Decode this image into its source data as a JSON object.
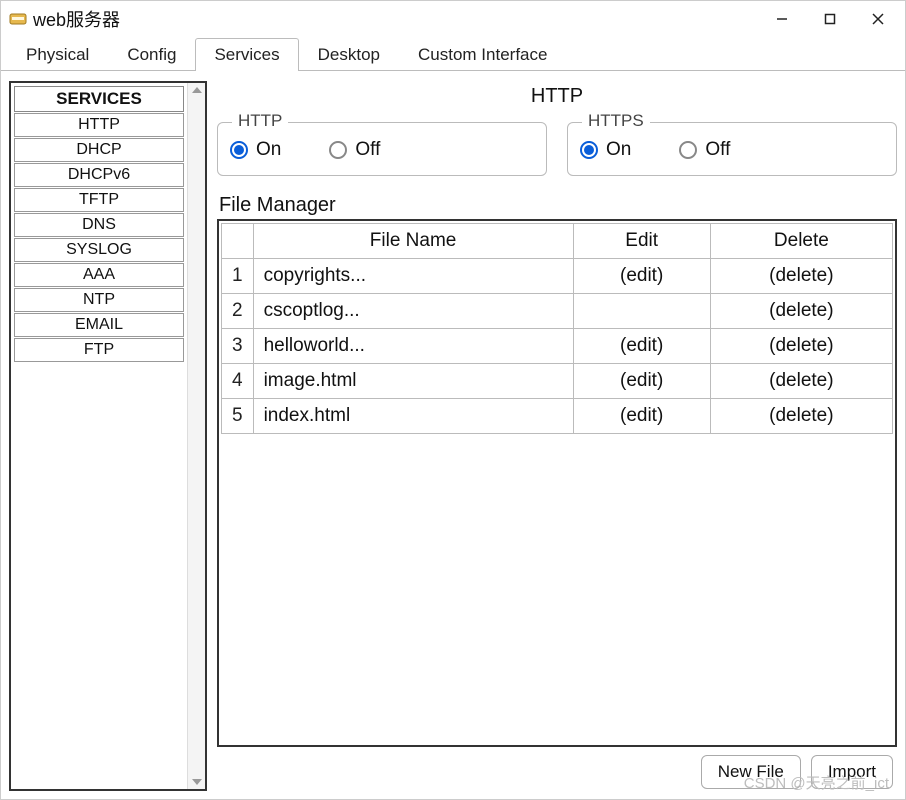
{
  "window": {
    "title": "web服务器"
  },
  "tabs": {
    "physical": "Physical",
    "config": "Config",
    "services": "Services",
    "desktop": "Desktop",
    "custom": "Custom Interface",
    "active": "services"
  },
  "sidebar": {
    "header": "SERVICES",
    "items": [
      "HTTP",
      "DHCP",
      "DHCPv6",
      "TFTP",
      "DNS",
      "SYSLOG",
      "AAA",
      "NTP",
      "EMAIL",
      "FTP"
    ]
  },
  "panel": {
    "title": "HTTP",
    "http": {
      "legend": "HTTP",
      "on_label": "On",
      "off_label": "Off",
      "on": true
    },
    "https": {
      "legend": "HTTPS",
      "on_label": "On",
      "off_label": "Off",
      "on": true
    },
    "file_manager_label": "File Manager",
    "table": {
      "headers": {
        "filename": "File Name",
        "edit": "Edit",
        "delete": "Delete"
      },
      "rows": [
        {
          "n": "1",
          "file": "copyrights...",
          "edit": "(edit)",
          "del": "(delete)"
        },
        {
          "n": "2",
          "file": "cscoptlog...",
          "edit": "",
          "del": "(delete)"
        },
        {
          "n": "3",
          "file": "helloworld...",
          "edit": "(edit)",
          "del": "(delete)"
        },
        {
          "n": "4",
          "file": "image.html",
          "edit": "(edit)",
          "del": "(delete)"
        },
        {
          "n": "5",
          "file": "index.html",
          "edit": "(edit)",
          "del": "(delete)"
        }
      ]
    },
    "buttons": {
      "new_file": "New File",
      "import": "Import"
    }
  },
  "watermark": "CSDN @天亮之前_ict"
}
